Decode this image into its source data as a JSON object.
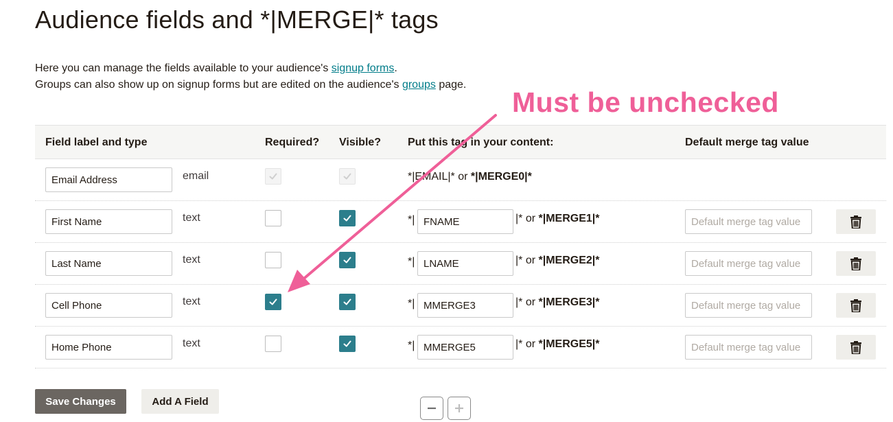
{
  "page": {
    "title": "Audience fields and *|MERGE|* tags",
    "intro_line1_pre": "Here you can manage the fields available to your audience's ",
    "intro_link1": "signup forms",
    "intro_line1_post": ".",
    "intro_line2_pre": "Groups can also show up on signup forms but are edited on the audience's ",
    "intro_link2": "groups",
    "intro_line2_post": " page."
  },
  "annotation": {
    "text": "Must be unchecked",
    "color": "#ef5f98"
  },
  "table": {
    "headers": {
      "label": "Field label and type",
      "required": "Required?",
      "visible": "Visible?",
      "tag": "Put this tag in your content:",
      "default": "Default merge tag value"
    },
    "rows": [
      {
        "label": "Email Address",
        "type": "email",
        "required": true,
        "visible": true,
        "locked": true,
        "tag_full": "*|EMAIL|* or ",
        "merge_alt": "*|MERGE0|*"
      },
      {
        "label": "First Name",
        "type": "text",
        "required": false,
        "visible": true,
        "tag_prefix": "*|",
        "tag": "FNAME",
        "tag_suffix": "|* or ",
        "merge_alt": "*|MERGE1|*",
        "default_placeholder": "Default merge tag value"
      },
      {
        "label": "Last Name",
        "type": "text",
        "required": false,
        "visible": true,
        "tag_prefix": "*|",
        "tag": "LNAME",
        "tag_suffix": "|* or ",
        "merge_alt": "*|MERGE2|*",
        "default_placeholder": "Default merge tag value"
      },
      {
        "label": "Cell Phone",
        "type": "text",
        "required": true,
        "visible": true,
        "tag_prefix": "*|",
        "tag": "MMERGE3",
        "tag_suffix": "|* or ",
        "merge_alt": "*|MERGE3|*",
        "default_placeholder": "Default merge tag value"
      },
      {
        "label": "Home Phone",
        "type": "text",
        "required": false,
        "visible": true,
        "tag_prefix": "*|",
        "tag": "MMERGE5",
        "tag_suffix": "|* or ",
        "merge_alt": "*|MERGE5|*",
        "default_placeholder": "Default merge tag value"
      }
    ]
  },
  "actions": {
    "save_label": "Save Changes",
    "add_label": "Add A Field"
  },
  "zoom": {
    "out_icon": "minus-icon",
    "in_icon": "plus-icon"
  },
  "colors": {
    "checkbox_checked": "#2c7e8c",
    "link": "#007c89",
    "save_button": "#6b6661"
  }
}
